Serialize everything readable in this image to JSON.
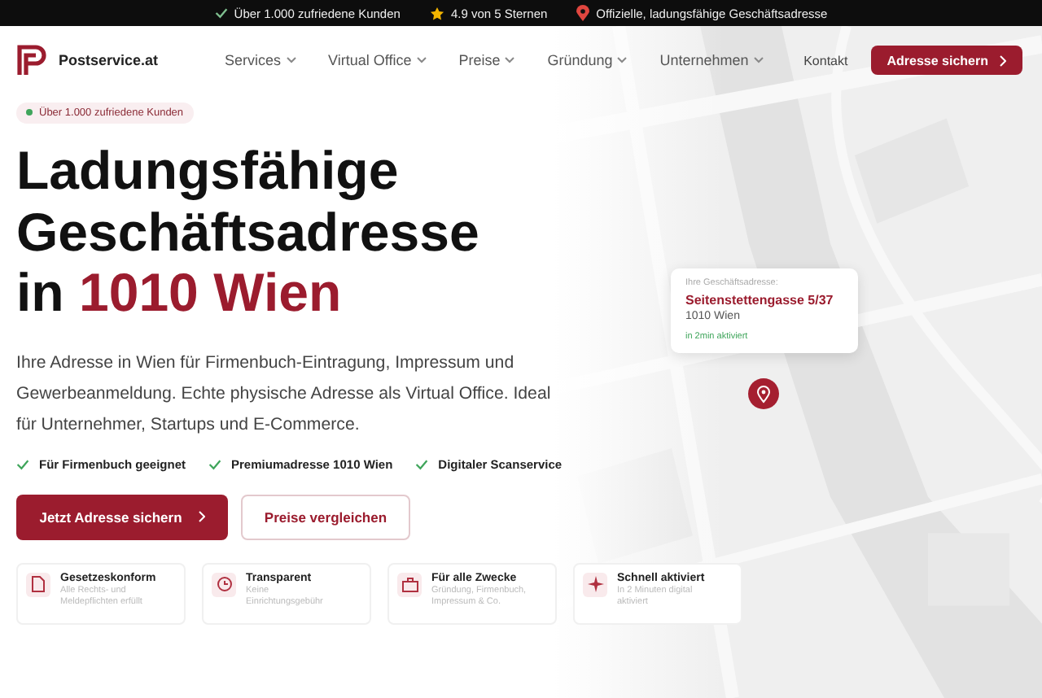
{
  "top_bar": [
    {
      "kind": "check",
      "text": "Über 1.000 zufriedene Kunden"
    },
    {
      "kind": "star",
      "text": "4.9 von 5 Sternen"
    },
    {
      "kind": "pin",
      "text": "Offizielle, ladungsfähige Geschäftsadresse"
    }
  ],
  "nav": {
    "logo": "Postservice.at",
    "menu": [
      "Services",
      "Virtual Office",
      "Preise",
      "Gründung",
      "Unternehmen"
    ],
    "contact": "Kontakt",
    "cta": "Adresse sichern"
  },
  "hero": {
    "badge": "Über 1.000 zufriedene Kunden",
    "headline_lines": [
      "Ladungsfähige",
      "Geschäftsadresse"
    ],
    "headline_prefix": "in",
    "headline_accent": "1010 Wien",
    "description": "Ihre Adresse in Wien für Firmenbuch-Eintragung, Impressum und Gewerbeanmeldung. Echte physische Adresse als Virtual Office. Ideal für Unternehmer, Startups und E-Commerce.",
    "checks": [
      "Für Firmenbuch geeignet",
      "Premiumadresse 1010 Wien",
      "Digitaler Scanservice"
    ],
    "primary_button": "Jetzt Adresse sichern",
    "secondary_button": "Preise vergleichen"
  },
  "map": {
    "card": {
      "label": "Ihre Geschäftsadresse:",
      "street": "Seitenstettengasse 5/37",
      "city": "1010 Wien",
      "status": "in 2min aktiviert"
    }
  },
  "features": [
    {
      "kind": "document",
      "title": "Gesetzeskonform",
      "text": "Alle Rechts- und Meldepflichten erfüllt"
    },
    {
      "kind": "clock",
      "title": "Transparent",
      "text": "Keine Einrichtungsgebühr"
    },
    {
      "kind": "briefcase",
      "title": "Für alle Zwecke",
      "text": "Gründung, Firmenbuch, Impressum & Co."
    },
    {
      "kind": "sparkle",
      "title": "Schnell aktiviert",
      "text": "In 2 Minuten digital aktiviert"
    }
  ]
}
